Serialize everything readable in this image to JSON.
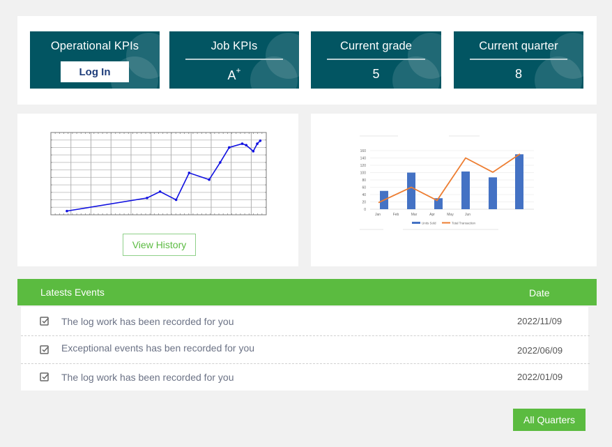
{
  "kpis": [
    {
      "title": "Operational KPIs",
      "button_label": "Log In"
    },
    {
      "title": "Job KPIs",
      "value": "A",
      "value_sup": "+"
    },
    {
      "title": "Current grade",
      "value": "5"
    },
    {
      "title": "Current quarter",
      "value": "8"
    }
  ],
  "history": {
    "button_label": "View History"
  },
  "chart_data": [
    {
      "type": "line",
      "title": "",
      "xlabel": "",
      "ylabel": "",
      "grid": true,
      "x": [
        0.8,
        4.8,
        5.45,
        6.25,
        6.9,
        7.9,
        8.45,
        8.9,
        9.55,
        9.75,
        10.1,
        10.3,
        10.45
      ],
      "values": [
        0.5,
        2.25,
        3.1,
        2.0,
        5.6,
        4.7,
        7.0,
        9.0,
        9.5,
        9.3,
        8.5,
        9.5,
        9.9
      ],
      "xlim": [
        0,
        10.75
      ],
      "ylim": [
        0,
        11
      ],
      "color": "#1010e0"
    },
    {
      "type": "bar",
      "title": "",
      "categories": [
        "Jan",
        "Feb",
        "Mar",
        "Apr",
        "May",
        "Jun"
      ],
      "series": [
        {
          "name": "Units Sold",
          "type": "bar",
          "color": "#4472c4",
          "values": [
            50,
            100,
            30,
            103,
            87,
            150
          ]
        },
        {
          "name": "Total Transaction",
          "type": "line",
          "color": "#ed7d31",
          "values": [
            18,
            60,
            24,
            140,
            101,
            151
          ]
        }
      ],
      "yticks": [
        0,
        20,
        40,
        60,
        80,
        100,
        120,
        140,
        160
      ],
      "ylim": [
        0,
        160
      ],
      "legend": "bottom",
      "grid": true
    }
  ],
  "events": {
    "header_title": "Latests Events",
    "header_date": "Date",
    "rows": [
      {
        "icon": "checkbox-checked-icon",
        "message": "The log work has been recorded for you",
        "date": "2022/11/09"
      },
      {
        "icon": "checkbox-checked-icon",
        "message": "Exceptional events has ben recorded for you",
        "date": "2022/06/09"
      },
      {
        "icon": "checkbox-checked-icon",
        "message": "The log work has been recorded for you",
        "date": "2022/01/09"
      }
    ]
  },
  "footer": {
    "all_quarters_label": "All Quarters"
  },
  "colors": {
    "kpi_bg": "#025562",
    "accent_green": "#5bbb40",
    "bar_blue": "#4472c4",
    "line_orange": "#ed7d31",
    "history_line": "#1010e0"
  }
}
